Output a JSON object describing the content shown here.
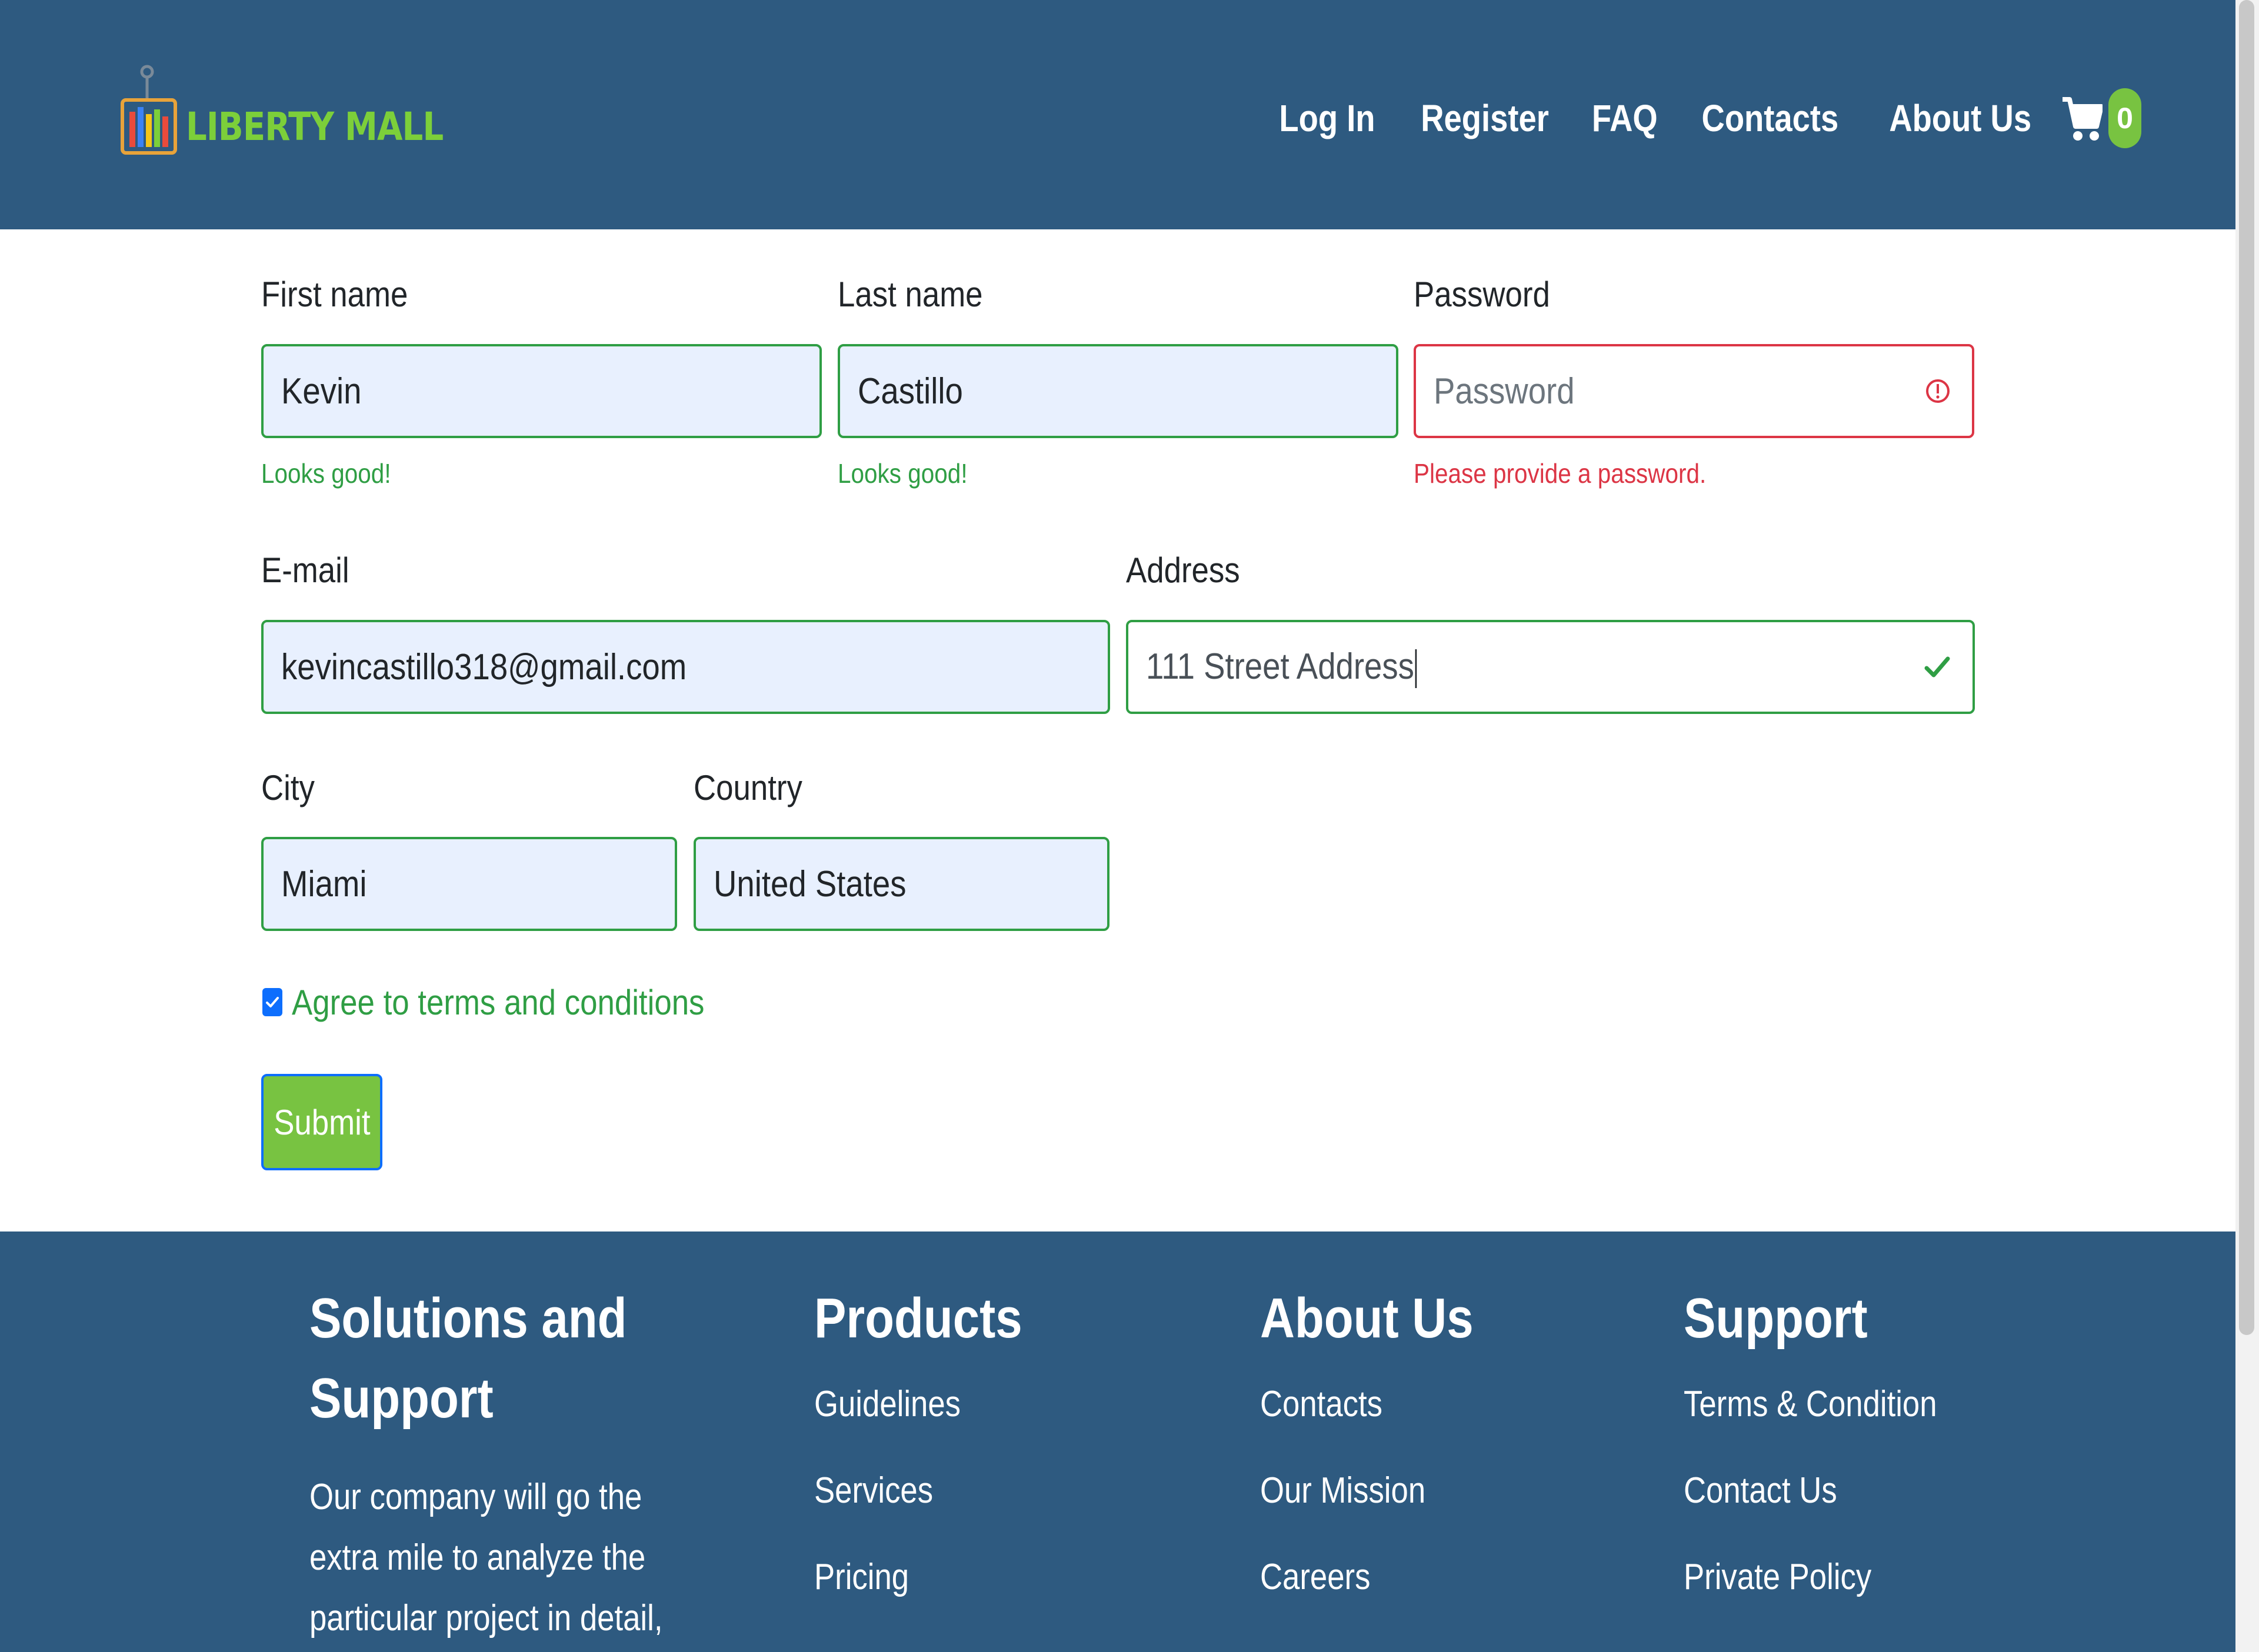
{
  "header": {
    "logo_text": "LIBERTY MALL",
    "nav": [
      "Log In",
      "Register",
      "FAQ",
      "Contacts",
      "About Us"
    ],
    "cart_count": "0",
    "colors": {
      "background": "#2e5a80",
      "accent": "#78c341"
    }
  },
  "form": {
    "first_name": {
      "label": "First name",
      "value": "Kevin",
      "feedback": "Looks good!"
    },
    "last_name": {
      "label": "Last name",
      "value": "Castillo",
      "feedback": "Looks good!"
    },
    "password": {
      "label": "Password",
      "placeholder": "Password",
      "feedback": "Please provide a password."
    },
    "email": {
      "label": "E-mail",
      "value": "kevincastillo318@gmail.com"
    },
    "address": {
      "label": "Address",
      "value": "111 Street Address"
    },
    "city": {
      "label": "City",
      "value": "Miami"
    },
    "country": {
      "label": "Country",
      "value": "United States"
    },
    "terms": {
      "label": "Agree to terms and conditions",
      "checked": true
    },
    "submit_label": "Submit",
    "colors": {
      "valid": "#2f9e44",
      "invalid": "#dc3545",
      "autofill": "#e8f0fe"
    }
  },
  "footer": {
    "solutions": {
      "heading_line1": "Solutions and",
      "heading_line2": "Support",
      "desc_lines": [
        "Our company will go the",
        "extra mile to analyze the",
        "particular project in detail,"
      ]
    },
    "products": {
      "heading": "Products",
      "links": [
        "Guidelines",
        "Services",
        "Pricing"
      ]
    },
    "about": {
      "heading": "About Us",
      "links": [
        "Contacts",
        "Our Mission",
        "Careers"
      ]
    },
    "support": {
      "heading": "Support",
      "links": [
        "Terms & Condition",
        "Contact Us",
        "Private Policy"
      ]
    }
  }
}
